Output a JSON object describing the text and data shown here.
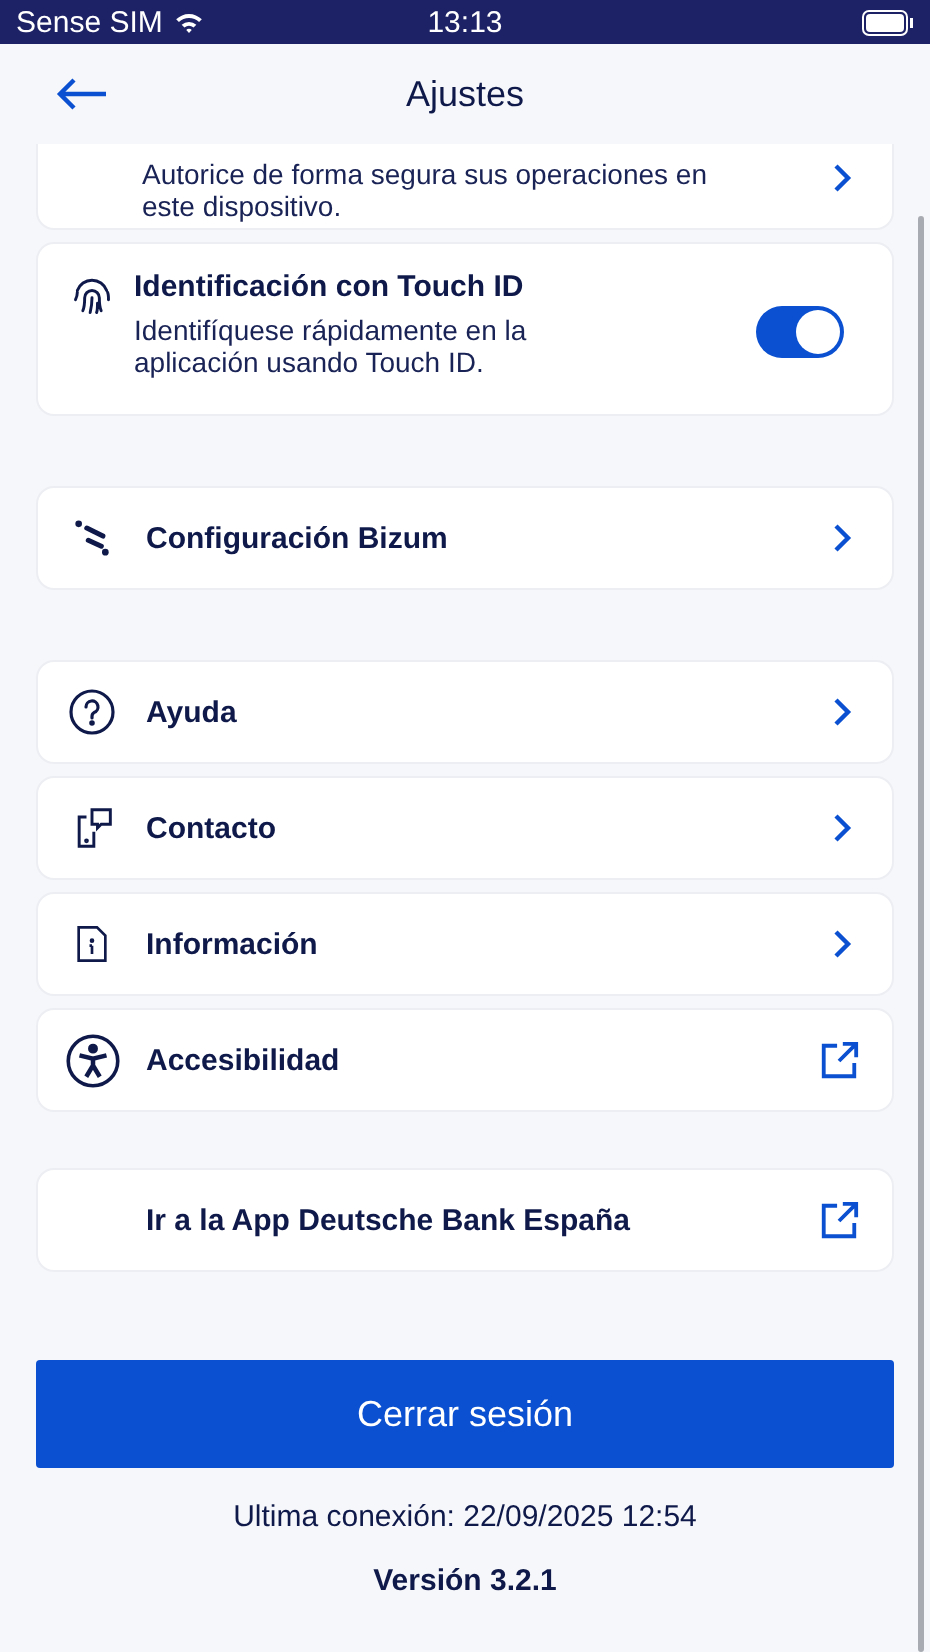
{
  "status_bar": {
    "carrier": "Sense SIM",
    "time": "13:13"
  },
  "header": {
    "title": "Ajustes"
  },
  "partial_card": {
    "description": "Autorice de forma segura sus operaciones en este dispositivo."
  },
  "touch_id": {
    "title": "Identificación con Touch ID",
    "description": "Identifíquese rápidamente en la aplicación usando Touch ID.",
    "on": true
  },
  "sections": [
    [
      {
        "label": "Configuración Bizum",
        "kind": "bizum"
      }
    ],
    [
      {
        "label": "Ayuda",
        "kind": "help"
      },
      {
        "label": "Contacto",
        "kind": "contact"
      },
      {
        "label": "Información",
        "kind": "info"
      },
      {
        "label": "Accesibilidad",
        "kind": "accessibility"
      }
    ],
    [
      {
        "label": "Ir a la App Deutsche Bank España",
        "kind": "link"
      }
    ]
  ],
  "logout_button": "Cerrar sesión",
  "last_connection": "Ultima conexión: 22/09/2025 12:54",
  "version": "Versión 3.2.1"
}
